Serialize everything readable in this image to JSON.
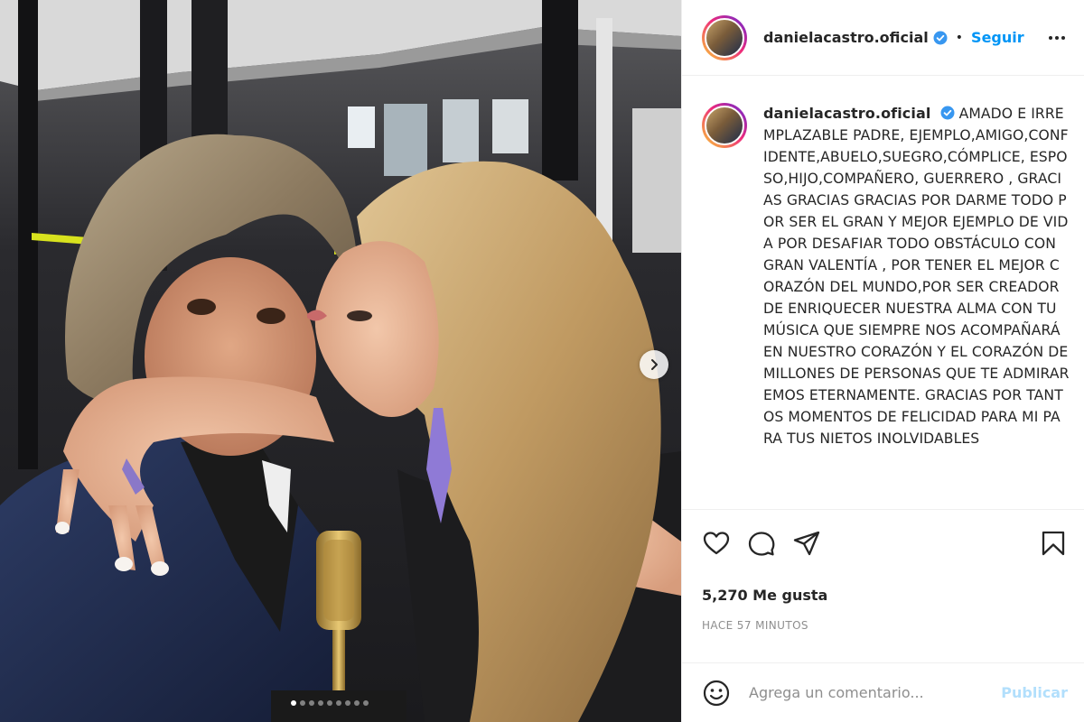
{
  "post": {
    "username": "danielacastro.oficial",
    "separator": "•",
    "follow_label": "Seguir",
    "caption": "AMADO E IRREMPLAZABLE PADRE, EJEMPLO,AMIGO,CONFIDENTE,ABUELO,SUEGRO,CÓMPLICE, ESPOSO,HIJO,COMPAÑERO, GUERRERO , GRACIAS GRACIAS GRACIAS POR DARME TODO POR SER EL GRAN Y MEJOR EJEMPLO DE VIDA POR DESAFIAR TODO OBSTÁCULO CON GRAN VALENTÍA , POR TENER EL MEJOR CORAZÓN DEL MUNDO,POR SER CREADOR DE ENRIQUECER NUESTRA ALMA CON TU MÚSICA QUE SIEMPRE NOS ACOMPAÑARÁ EN NUESTRO CORAZÓN Y EL CORAZÓN DE MILLONES DE PERSONAS QUE TE ADMIRAREMOS ETERNAMENTE. GRACIAS POR TANTOS MOMENTOS DE FELICIDAD PARA MI PARA TUS NIETOS INOLVIDABLES",
    "likes": "5,270 Me gusta",
    "timestamp": "HACE 57 MINUTOS"
  },
  "comment_box": {
    "placeholder": "Agrega un comentario...",
    "publish_label": "Publicar"
  },
  "carousel": {
    "slide_count": 9,
    "active_index": 0
  },
  "icons": {
    "verified": "verified-badge-icon",
    "more": "more-options-icon",
    "like": "heart-icon",
    "comment": "comment-icon",
    "share": "share-icon",
    "save": "bookmark-icon",
    "emoji": "emoji-icon",
    "next": "chevron-right-icon"
  },
  "colors": {
    "accent": "#0095f6",
    "publish_disabled": "#b2dffc",
    "muted": "#8e8e8e",
    "verified": "#3897f0"
  }
}
